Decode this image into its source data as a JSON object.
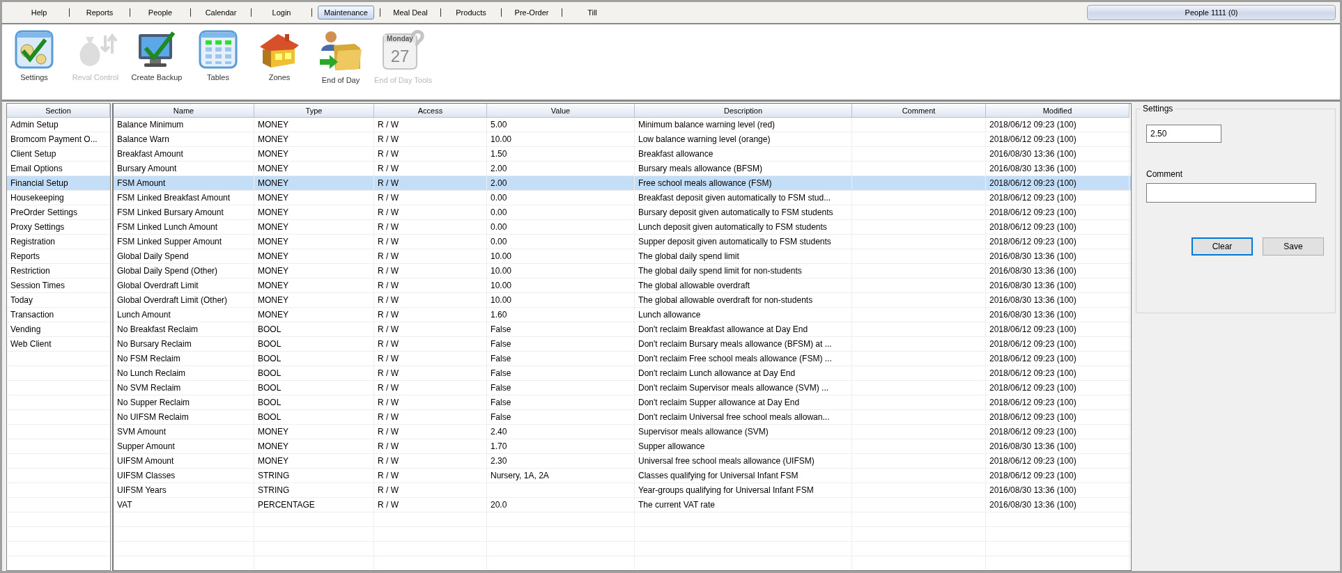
{
  "menu": [
    {
      "label": "Help",
      "selected": false
    },
    {
      "label": "Reports",
      "selected": false
    },
    {
      "label": "People",
      "selected": false
    },
    {
      "label": "Calendar",
      "selected": false
    },
    {
      "label": "Login",
      "selected": false
    },
    {
      "label": "Maintenance",
      "selected": true
    },
    {
      "label": "Meal Deal",
      "selected": false
    },
    {
      "label": "Products",
      "selected": false
    },
    {
      "label": "Pre-Order",
      "selected": false
    },
    {
      "label": "Till",
      "selected": false
    }
  ],
  "people_button": "People 1111 (0)",
  "toolbar": [
    {
      "kind": "settings",
      "label": "Settings",
      "disabled": false
    },
    {
      "kind": "reval",
      "label": "Reval Control",
      "disabled": true
    },
    {
      "kind": "backup",
      "label": "Create Backup",
      "disabled": false
    },
    {
      "kind": "tables",
      "label": "Tables",
      "disabled": false
    },
    {
      "kind": "zones",
      "label": "Zones",
      "disabled": false
    },
    {
      "kind": "endofday",
      "label": "End of Day",
      "disabled": false
    },
    {
      "kind": "calendar",
      "label": "End of Day Tools",
      "disabled": true,
      "day": "Monday",
      "date": "27"
    }
  ],
  "sections": {
    "header": "Section",
    "items": [
      {
        "label": "Admin Setup",
        "selected": false
      },
      {
        "label": "Bromcom Payment O...",
        "selected": false
      },
      {
        "label": "Client Setup",
        "selected": false
      },
      {
        "label": "Email Options",
        "selected": false
      },
      {
        "label": "Financial Setup",
        "selected": true
      },
      {
        "label": "Housekeeping",
        "selected": false
      },
      {
        "label": "PreOrder Settings",
        "selected": false
      },
      {
        "label": "Proxy Settings",
        "selected": false
      },
      {
        "label": "Registration",
        "selected": false
      },
      {
        "label": "Reports",
        "selected": false
      },
      {
        "label": "Restriction",
        "selected": false
      },
      {
        "label": "Session Times",
        "selected": false
      },
      {
        "label": "Today",
        "selected": false
      },
      {
        "label": "Transaction",
        "selected": false
      },
      {
        "label": "Vending",
        "selected": false
      },
      {
        "label": "Web Client",
        "selected": false
      }
    ]
  },
  "table": {
    "columns": [
      "Name",
      "Type",
      "Access",
      "Value",
      "Description",
      "Comment",
      "Modified"
    ],
    "rows": [
      {
        "name": "Balance Minimum",
        "type": "MONEY",
        "access": "R / W",
        "value": "5.00",
        "description": "Minimum balance warning level (red)",
        "modified": "2018/06/12 09:23 (100)",
        "selected": false
      },
      {
        "name": "Balance Warn",
        "type": "MONEY",
        "access": "R / W",
        "value": "10.00",
        "description": "Low balance warning level (orange)",
        "modified": "2018/06/12 09:23 (100)",
        "selected": false
      },
      {
        "name": "Breakfast Amount",
        "type": "MONEY",
        "access": "R / W",
        "value": "1.50",
        "description": "Breakfast allowance",
        "modified": "2016/08/30 13:36 (100)",
        "selected": false
      },
      {
        "name": "Bursary Amount",
        "type": "MONEY",
        "access": "R / W",
        "value": "2.00",
        "description": "Bursary meals allowance (BFSM)",
        "modified": "2016/08/30 13:36 (100)",
        "selected": false
      },
      {
        "name": "FSM Amount",
        "type": "MONEY",
        "access": "R / W",
        "value": "2.00",
        "description": "Free school meals allowance (FSM)",
        "modified": "2018/06/12 09:23 (100)",
        "selected": true
      },
      {
        "name": "FSM Linked Breakfast Amount",
        "type": "MONEY",
        "access": "R / W",
        "value": "0.00",
        "description": "Breakfast deposit given automatically to FSM stud...",
        "modified": "2018/06/12 09:23 (100)",
        "selected": false
      },
      {
        "name": "FSM Linked Bursary Amount",
        "type": "MONEY",
        "access": "R / W",
        "value": "0.00",
        "description": "Bursary deposit given automatically to FSM students",
        "modified": "2018/06/12 09:23 (100)",
        "selected": false
      },
      {
        "name": "FSM Linked Lunch Amount",
        "type": "MONEY",
        "access": "R / W",
        "value": "0.00",
        "description": "Lunch deposit given automatically to FSM students",
        "modified": "2018/06/12 09:23 (100)",
        "selected": false
      },
      {
        "name": "FSM Linked Supper Amount",
        "type": "MONEY",
        "access": "R / W",
        "value": "0.00",
        "description": "Supper deposit given automatically to FSM students",
        "modified": "2018/06/12 09:23 (100)",
        "selected": false
      },
      {
        "name": "Global Daily Spend",
        "type": "MONEY",
        "access": "R / W",
        "value": "10.00",
        "description": "The global daily spend limit",
        "modified": "2016/08/30 13:36 (100)",
        "selected": false
      },
      {
        "name": "Global Daily Spend (Other)",
        "type": "MONEY",
        "access": "R / W",
        "value": "10.00",
        "description": "The global daily spend limit for non-students",
        "modified": "2016/08/30 13:36 (100)",
        "selected": false
      },
      {
        "name": "Global Overdraft Limit",
        "type": "MONEY",
        "access": "R / W",
        "value": "10.00",
        "description": "The global allowable overdraft",
        "modified": "2016/08/30 13:36 (100)",
        "selected": false
      },
      {
        "name": "Global Overdraft Limit (Other)",
        "type": "MONEY",
        "access": "R / W",
        "value": "10.00",
        "description": "The global allowable overdraft for non-students",
        "modified": "2016/08/30 13:36 (100)",
        "selected": false
      },
      {
        "name": "Lunch Amount",
        "type": "MONEY",
        "access": "R / W",
        "value": "1.60",
        "description": "Lunch allowance",
        "modified": "2016/08/30 13:36 (100)",
        "selected": false
      },
      {
        "name": "No Breakfast Reclaim",
        "type": "BOOL",
        "access": "R / W",
        "value": "False",
        "description": "Don't reclaim Breakfast allowance at Day End",
        "modified": "2018/06/12 09:23 (100)",
        "selected": false
      },
      {
        "name": "No Bursary Reclaim",
        "type": "BOOL",
        "access": "R / W",
        "value": "False",
        "description": "Don't reclaim Bursary meals allowance (BFSM) at ...",
        "modified": "2018/06/12 09:23 (100)",
        "selected": false
      },
      {
        "name": "No FSM Reclaim",
        "type": "BOOL",
        "access": "R / W",
        "value": "False",
        "description": "Don't reclaim Free school meals allowance (FSM) ...",
        "modified": "2018/06/12 09:23 (100)",
        "selected": false
      },
      {
        "name": "No Lunch Reclaim",
        "type": "BOOL",
        "access": "R / W",
        "value": "False",
        "description": "Don't reclaim Lunch allowance at Day End",
        "modified": "2018/06/12 09:23 (100)",
        "selected": false
      },
      {
        "name": "No SVM Reclaim",
        "type": "BOOL",
        "access": "R / W",
        "value": "False",
        "description": "Don't reclaim Supervisor meals allowance (SVM) ...",
        "modified": "2018/06/12 09:23 (100)",
        "selected": false
      },
      {
        "name": "No Supper Reclaim",
        "type": "BOOL",
        "access": "R / W",
        "value": "False",
        "description": "Don't reclaim Supper allowance at Day End",
        "modified": "2018/06/12 09:23 (100)",
        "selected": false
      },
      {
        "name": "No UIFSM Reclaim",
        "type": "BOOL",
        "access": "R / W",
        "value": "False",
        "description": "Don't reclaim Universal free school meals allowan...",
        "modified": "2018/06/12 09:23 (100)",
        "selected": false
      },
      {
        "name": "SVM Amount",
        "type": "MONEY",
        "access": "R / W",
        "value": "2.40",
        "description": "Supervisor meals allowance (SVM)",
        "modified": "2018/06/12 09:23 (100)",
        "selected": false
      },
      {
        "name": "Supper Amount",
        "type": "MONEY",
        "access": "R / W",
        "value": "1.70",
        "description": "Supper allowance",
        "modified": "2016/08/30 13:36 (100)",
        "selected": false
      },
      {
        "name": "UIFSM Amount",
        "type": "MONEY",
        "access": "R / W",
        "value": "2.30",
        "description": "Universal free school meals allowance (UIFSM)",
        "modified": "2018/06/12 09:23 (100)",
        "selected": false
      },
      {
        "name": "UIFSM Classes",
        "type": "STRING",
        "access": "R / W",
        "value": "Nursery, 1A, 2A",
        "description": "Classes qualifying for Universal Infant FSM",
        "modified": "2018/06/12 09:23 (100)",
        "selected": false
      },
      {
        "name": "UIFSM Years",
        "type": "STRING",
        "access": "R / W",
        "description": "Year-groups qualifying for Universal Infant FSM",
        "modified": "2016/08/30 13:36 (100)",
        "selected": false
      },
      {
        "name": "VAT",
        "type": "PERCENTAGE",
        "access": "R / W",
        "value": "20.0",
        "description": "The current VAT rate",
        "modified": "2016/08/30 13:36 (100)",
        "selected": false
      }
    ]
  },
  "editor": {
    "title": "Settings",
    "value": "2.50",
    "comment_label": "Comment",
    "buttons": [
      {
        "label": "Clear",
        "focused": true
      },
      {
        "label": "Save",
        "focused": false
      }
    ]
  }
}
